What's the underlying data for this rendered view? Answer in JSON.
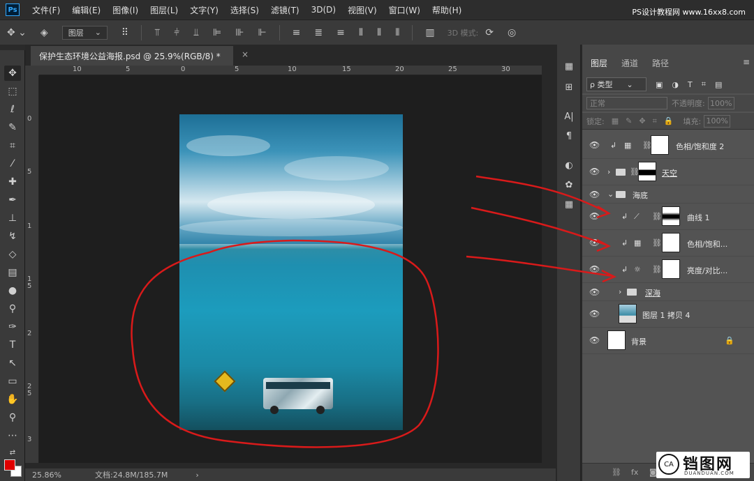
{
  "menu": {
    "logo": "Ps",
    "items": [
      "文件(F)",
      "编辑(E)",
      "图像(I)",
      "图层(L)",
      "文字(Y)",
      "选择(S)",
      "滤镜(T)",
      "3D(D)",
      "视图(V)",
      "窗口(W)",
      "帮助(H)"
    ],
    "watermark": "PS设计教程网 www.16xx8.com"
  },
  "options": {
    "select_label": "图层",
    "three_d_mode": "3D 模式:"
  },
  "document": {
    "tab_title": "保护生态环境公益海报.psd @ 25.9%(RGB/8) *",
    "close_glyph": "×"
  },
  "ruler": {
    "top_ticks": [
      "10",
      "5",
      "0",
      "5",
      "10",
      "15",
      "20",
      "25",
      "30"
    ],
    "left_ticks": [
      "0",
      "5",
      "1",
      "1 5",
      "2",
      "2 5",
      "3"
    ]
  },
  "status": {
    "zoom": "25.86%",
    "doc_size": "文档:24.8M/185.7M",
    "arrow": "›"
  },
  "panel": {
    "tabs": [
      "图层",
      "通道",
      "路径"
    ],
    "filter_label": "ρ 类型",
    "blend_mode": "正常",
    "opacity_label": "不透明度:",
    "opacity_value": "100%",
    "lock_label": "锁定:",
    "fill_label": "填充:",
    "fill_value": "100%"
  },
  "layers": [
    {
      "name": "色相/饱和度 2",
      "kind": "adjustment"
    },
    {
      "name": "天空",
      "kind": "group"
    },
    {
      "name": "海底",
      "kind": "group-open"
    },
    {
      "name": "曲线 1",
      "kind": "adjustment"
    },
    {
      "name": "色相/饱和...",
      "kind": "adjustment"
    },
    {
      "name": "亮度/对比...",
      "kind": "adjustment"
    },
    {
      "name": "深海",
      "kind": "group"
    },
    {
      "name": "图层 1 拷贝 4",
      "kind": "pixel"
    },
    {
      "name": "背景",
      "kind": "background"
    }
  ],
  "brand": {
    "logo_text": "CA",
    "name": "铛图网",
    "url": "DUANDUAN.COM"
  },
  "colors": {
    "foreground": "#e00000",
    "background": "#ffffff",
    "annotation": "#d91a1a"
  }
}
